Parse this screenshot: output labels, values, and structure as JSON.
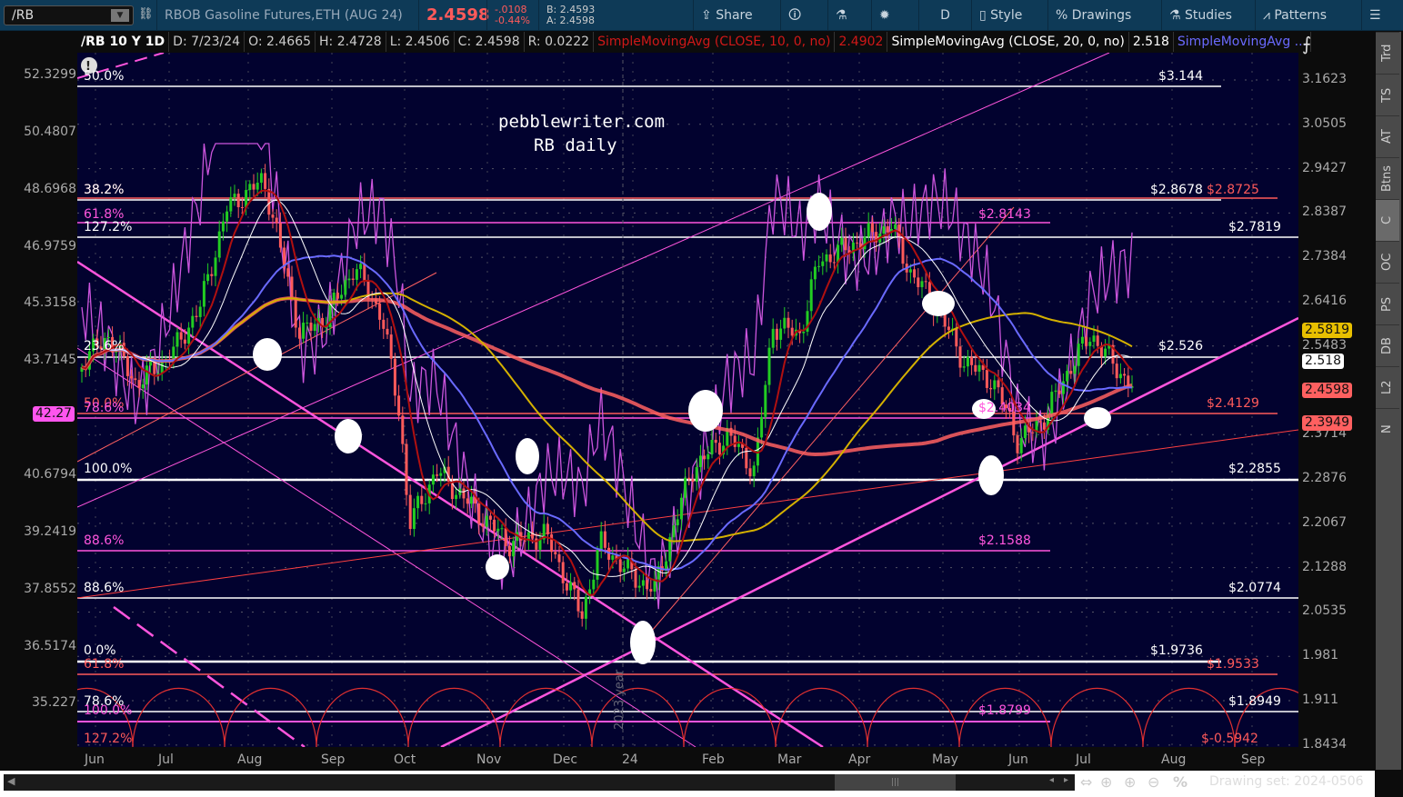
{
  "toolbar": {
    "symbol": "/RB",
    "description": "RBOB Gasoline Futures,ETH (AUG 24)",
    "last": "2.4598",
    "change": "-.0108",
    "change_pct": "-0.44%",
    "bid": "B: 2.4593",
    "ask": "A: 2.4598",
    "share": "Share",
    "period": "D",
    "style": "Style",
    "drawings": "Drawings",
    "studies": "Studies",
    "patterns": "Patterns"
  },
  "info": {
    "title": "/RB 10 Y 1D",
    "date": "D: 7/23/24",
    "open": "O: 2.4665",
    "high": "H: 2.4728",
    "low": "L: 2.4506",
    "close": "C: 2.4598",
    "range": "R: 0.0222",
    "sma10": "SimpleMovingAvg (CLOSE, 10, 0, no)",
    "sma10_val": "2.4902",
    "sma20": "SimpleMovingAvg (CLOSE, 20, 0, no)",
    "sma20_val": "2.518",
    "sma_more": "SimpleMovingAvg ..."
  },
  "watermark": {
    "line1": "pebblewriter.com",
    "line2": "RB daily",
    "year": "2023 year"
  },
  "right_axis": [
    "3.1623",
    "3.0505",
    "2.9427",
    "2.8387",
    "2.7384",
    "2.6416",
    "2.5483",
    "2.3714",
    "2.2876",
    "2.2067",
    "2.1288",
    "2.0535",
    "1.981",
    "1.911",
    "1.8434"
  ],
  "left_axis": [
    "52.3299",
    "50.4807",
    "48.6968",
    "46.9759",
    "45.3158",
    "43.7145",
    "40.6794",
    "39.2419",
    "37.8552",
    "36.5174",
    "35.227"
  ],
  "badges": {
    "yellow": "2.5819",
    "white": "2.518",
    "red1": "2.4598",
    "red2": "2.3949",
    "left": "42.27"
  },
  "fib_left": [
    "50.0%",
    "38.2%",
    "38.2%",
    "61.8%",
    "127.2%",
    "23.6%",
    "50.0%",
    "78.6%",
    "100.0%",
    "88.6%",
    "88.6%",
    "0.0%",
    "61.8%",
    "78.6%",
    "100.0%",
    "127.2%"
  ],
  "fib_right": [
    "$3.144",
    "$2.8678",
    "$2.8725",
    "$2.8143",
    "$2.7819",
    "$2.526",
    "$2.4129",
    "$2.4034",
    "$2.2855",
    "$2.1588",
    "$2.0774",
    "$1.9736",
    "$1.9533",
    "$1.8949",
    "$1.8799",
    "$-0.5942"
  ],
  "months": [
    "Jun",
    "Jul",
    "Aug",
    "Sep",
    "Oct",
    "Nov",
    "Dec",
    "24",
    "Feb",
    "Mar",
    "Apr",
    "May",
    "Jun",
    "Jul",
    "Aug",
    "Sep"
  ],
  "side_tabs": [
    "Trd",
    "TS",
    "AT",
    "Btns",
    "C",
    "OC",
    "PS",
    "DB",
    "L2",
    "N"
  ],
  "drawing_set": "Drawing set: 2024-0506",
  "colors": {
    "plot_bg": "#02022f",
    "toolbar": "#0e3a57",
    "up": "#22cc22",
    "down": "#ff5a5a",
    "sma10": "#b01010",
    "sma20": "#ffffff",
    "sma50": "#6a6aff",
    "sma100": "#d4b000",
    "sma200": "#ff6060",
    "osc": "#cc55dd",
    "fib_magenta": "#ff55dd"
  }
}
